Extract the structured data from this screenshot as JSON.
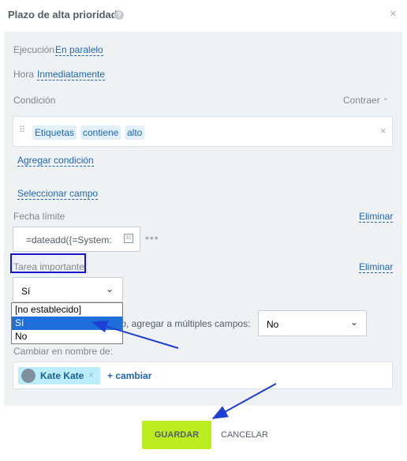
{
  "dialog": {
    "title": "Plazo de alta prioridad"
  },
  "ejecucion": {
    "label": "Ejecución",
    "value": "En paralelo"
  },
  "hora": {
    "label": "Hora",
    "value": "Inmediatamente"
  },
  "condicion": {
    "label": "Condición",
    "collapse": "Contraer",
    "tag1": "Etiquetas",
    "tag2": "contiene",
    "tag3": "alto",
    "add": "Agregar condición"
  },
  "select_field": "Seleccionar campo",
  "fecha": {
    "label": "Fecha límite",
    "value": "=dateadd({=System:N",
    "remove": "Eliminar",
    "calendar_day": "31"
  },
  "tarea": {
    "label": "Tarea importante",
    "value": "Sí",
    "remove": "Eliminar"
  },
  "dropdown": {
    "options": [
      "[no establecido]",
      "Sí",
      "No"
    ],
    "selected": "Sí"
  },
  "multi": {
    "label_partial": "llo, agregar a múltiples campos:",
    "value": "No"
  },
  "cambiar": {
    "label": "Cambiar en nombre de:",
    "user": "Kate Kate",
    "add": "+ cambiar"
  },
  "footer": {
    "save": "GUARDAR",
    "cancel": "CANCELAR"
  },
  "colors": {
    "highlight_box": "#1a14c8",
    "arrow": "#1d3fd6",
    "save_bg": "#bbed21"
  }
}
